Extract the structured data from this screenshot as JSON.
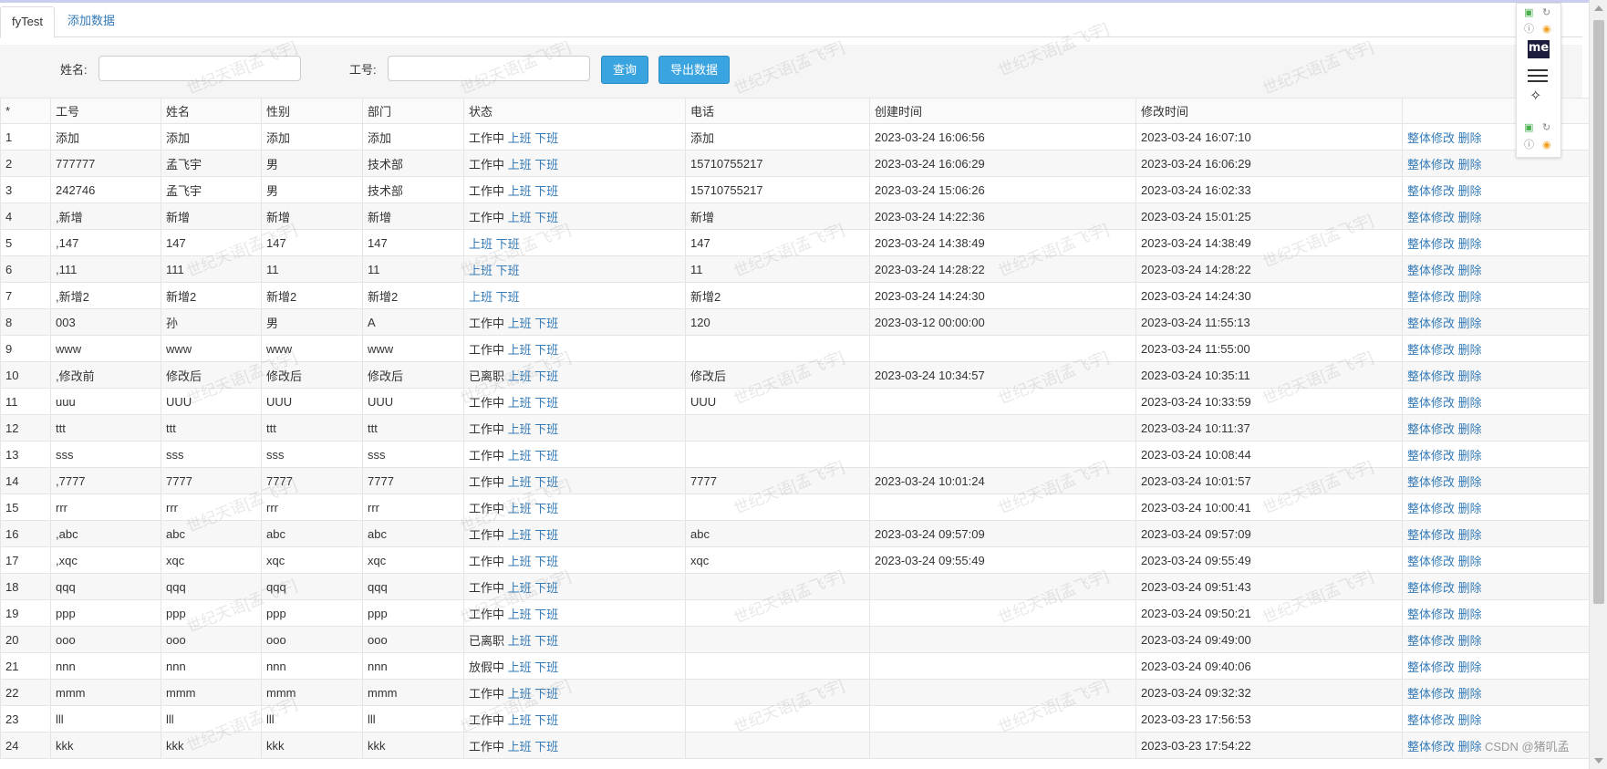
{
  "tabs": [
    {
      "label": "fyTest",
      "active": true
    },
    {
      "label": "添加数据",
      "active": false
    }
  ],
  "search": {
    "name_label": "姓名:",
    "name_value": "",
    "id_label": "工号:",
    "id_value": "",
    "query_button": "查询",
    "export_button": "导出数据"
  },
  "table": {
    "columns": [
      "*",
      "工号",
      "姓名",
      "性别",
      "部门",
      "状态",
      "电话",
      "创建时间",
      "修改时间",
      ""
    ],
    "action_on": "上班",
    "action_off": "下班",
    "action_edit": "整体修改",
    "action_delete": "删除",
    "rows": [
      {
        "n": "1",
        "id": "添加",
        "name": "添加",
        "gender": "添加",
        "dept": "添加",
        "status": "工作中",
        "phone": "添加",
        "created": "2023-03-24 16:06:56",
        "modified": "2023-03-24 16:07:10"
      },
      {
        "n": "2",
        "id": "777777",
        "name": "孟飞宇",
        "gender": "男",
        "dept": "技术部",
        "status": "工作中",
        "phone": "15710755217",
        "created": "2023-03-24 16:06:29",
        "modified": "2023-03-24 16:06:29"
      },
      {
        "n": "3",
        "id": "242746",
        "name": "孟飞宇",
        "gender": "男",
        "dept": "技术部",
        "status": "工作中",
        "phone": "15710755217",
        "created": "2023-03-24 15:06:26",
        "modified": "2023-03-24 16:02:33"
      },
      {
        "n": "4",
        "id": ",新增",
        "name": "新增",
        "gender": "新增",
        "dept": "新增",
        "status": "工作中",
        "phone": "新增",
        "created": "2023-03-24 14:22:36",
        "modified": "2023-03-24 15:01:25"
      },
      {
        "n": "5",
        "id": ",147",
        "name": "147",
        "gender": "147",
        "dept": "147",
        "status": "",
        "phone": "147",
        "created": "2023-03-24 14:38:49",
        "modified": "2023-03-24 14:38:49"
      },
      {
        "n": "6",
        "id": ",111",
        "name": "111",
        "gender": "11",
        "dept": "11",
        "status": "",
        "phone": "11",
        "created": "2023-03-24 14:28:22",
        "modified": "2023-03-24 14:28:22"
      },
      {
        "n": "7",
        "id": ",新增2",
        "name": "新增2",
        "gender": "新增2",
        "dept": "新增2",
        "status": "",
        "phone": "新增2",
        "created": "2023-03-24 14:24:30",
        "modified": "2023-03-24 14:24:30"
      },
      {
        "n": "8",
        "id": "003",
        "name": "孙",
        "gender": "男",
        "dept": "A",
        "status": "工作中",
        "phone": "120",
        "created": "2023-03-12 00:00:00",
        "modified": "2023-03-24 11:55:13"
      },
      {
        "n": "9",
        "id": "www",
        "name": "www",
        "gender": "www",
        "dept": "www",
        "status": "工作中",
        "phone": "",
        "created": "",
        "modified": "2023-03-24 11:55:00"
      },
      {
        "n": "10",
        "id": ",修改前",
        "name": "修改后",
        "gender": "修改后",
        "dept": "修改后",
        "status": "已离职",
        "phone": "修改后",
        "created": "2023-03-24 10:34:57",
        "modified": "2023-03-24 10:35:11"
      },
      {
        "n": "11",
        "id": "uuu",
        "name": "UUU",
        "gender": "UUU",
        "dept": "UUU",
        "status": "工作中",
        "phone": "UUU",
        "created": "",
        "modified": "2023-03-24 10:33:59"
      },
      {
        "n": "12",
        "id": "ttt",
        "name": "ttt",
        "gender": "ttt",
        "dept": "ttt",
        "status": "工作中",
        "phone": "",
        "created": "",
        "modified": "2023-03-24 10:11:37"
      },
      {
        "n": "13",
        "id": "sss",
        "name": "sss",
        "gender": "sss",
        "dept": "sss",
        "status": "工作中",
        "phone": "",
        "created": "",
        "modified": "2023-03-24 10:08:44"
      },
      {
        "n": "14",
        "id": ",7777",
        "name": "7777",
        "gender": "7777",
        "dept": "7777",
        "status": "工作中",
        "phone": "7777",
        "created": "2023-03-24 10:01:24",
        "modified": "2023-03-24 10:01:57"
      },
      {
        "n": "15",
        "id": "rrr",
        "name": "rrr",
        "gender": "rrr",
        "dept": "rrr",
        "status": "工作中",
        "phone": "",
        "created": "",
        "modified": "2023-03-24 10:00:41"
      },
      {
        "n": "16",
        "id": ",abc",
        "name": "abc",
        "gender": "abc",
        "dept": "abc",
        "status": "工作中",
        "phone": "abc",
        "created": "2023-03-24 09:57:09",
        "modified": "2023-03-24 09:57:09"
      },
      {
        "n": "17",
        "id": ",xqc",
        "name": "xqc",
        "gender": "xqc",
        "dept": "xqc",
        "status": "工作中",
        "phone": "xqc",
        "created": "2023-03-24 09:55:49",
        "modified": "2023-03-24 09:55:49"
      },
      {
        "n": "18",
        "id": "qqq",
        "name": "qqq",
        "gender": "qqq",
        "dept": "qqq",
        "status": "工作中",
        "phone": "",
        "created": "",
        "modified": "2023-03-24 09:51:43"
      },
      {
        "n": "19",
        "id": "ppp",
        "name": "ppp",
        "gender": "ppp",
        "dept": "ppp",
        "status": "工作中",
        "phone": "",
        "created": "",
        "modified": "2023-03-24 09:50:21"
      },
      {
        "n": "20",
        "id": "ooo",
        "name": "ooo",
        "gender": "ooo",
        "dept": "ooo",
        "status": "已离职",
        "phone": "",
        "created": "",
        "modified": "2023-03-24 09:49:00"
      },
      {
        "n": "21",
        "id": "nnn",
        "name": "nnn",
        "gender": "nnn",
        "dept": "nnn",
        "status": "放假中",
        "phone": "",
        "created": "",
        "modified": "2023-03-24 09:40:06"
      },
      {
        "n": "22",
        "id": "mmm",
        "name": "mmm",
        "gender": "mmm",
        "dept": "mmm",
        "status": "工作中",
        "phone": "",
        "created": "",
        "modified": "2023-03-24 09:32:32"
      },
      {
        "n": "23",
        "id": "lll",
        "name": "lll",
        "gender": "lll",
        "dept": "lll",
        "status": "工作中",
        "phone": "",
        "created": "",
        "modified": "2023-03-23 17:56:53"
      },
      {
        "n": "24",
        "id": "kkk",
        "name": "kkk",
        "gender": "kkk",
        "dept": "kkk",
        "status": "工作中",
        "phone": "",
        "created": "",
        "modified": "2023-03-23 17:54:22"
      }
    ]
  },
  "watermark": "世纪天语[孟飞宇]",
  "footer_credit": "CSDN @猪叽孟",
  "extension": {
    "logo": "me"
  },
  "colors": {
    "link": "#337ab7",
    "button": "#3aa4e0",
    "search_bg": "#f5f5f5"
  }
}
